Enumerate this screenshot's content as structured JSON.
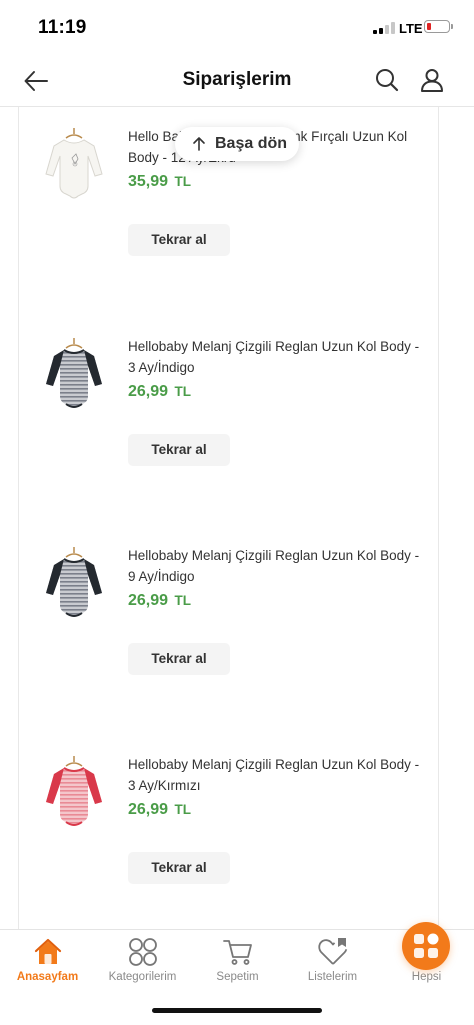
{
  "status_bar": {
    "time": "11:19",
    "network": "LTE"
  },
  "header": {
    "title": "Siparişlerim",
    "back_icon": "arrow-left-icon",
    "search_icon": "search-icon",
    "profile_icon": "user-icon"
  },
  "back_to_top": {
    "label": "Başa dön",
    "icon": "arrow-up-icon"
  },
  "orders": [
    {
      "name": "Hello Baby Basic Bebek Renk Fırçalı Uzun Kol Body - 12 Ay/Ekru",
      "price": "35,99",
      "currency": "TL",
      "reorder_label": "Tekrar al",
      "image": "bodysuit-white-icon"
    },
    {
      "name": "Hellobaby Melanj Çizgili Reglan Uzun Kol Body - 3 Ay/İndigo",
      "price": "26,99",
      "currency": "TL",
      "reorder_label": "Tekrar al",
      "image": "bodysuit-navy-striped-icon"
    },
    {
      "name": "Hellobaby Melanj Çizgili Reglan Uzun Kol Body - 9 Ay/İndigo",
      "price": "26,99",
      "currency": "TL",
      "reorder_label": "Tekrar al",
      "image": "bodysuit-navy-striped-icon"
    },
    {
      "name": "Hellobaby Melanj Çizgili Reglan Uzun Kol Body - 3 Ay/Kırmızı",
      "price": "26,99",
      "currency": "TL",
      "reorder_label": "Tekrar al",
      "image": "bodysuit-red-striped-icon"
    }
  ],
  "bottom_nav": {
    "items": [
      {
        "label": "Anasayfam",
        "icon": "home-icon",
        "active": true
      },
      {
        "label": "Kategorilerim",
        "icon": "categories-icon",
        "active": false
      },
      {
        "label": "Sepetim",
        "icon": "cart-icon",
        "active": false
      },
      {
        "label": "Listelerim",
        "icon": "heart-list-icon",
        "active": false
      },
      {
        "label": "Hepsi",
        "icon": "grid-icon",
        "active": false
      }
    ]
  },
  "colors": {
    "accent": "#f27a1a",
    "price": "#4a9c48",
    "text": "#333333",
    "button_bg": "#f4f4f4"
  }
}
